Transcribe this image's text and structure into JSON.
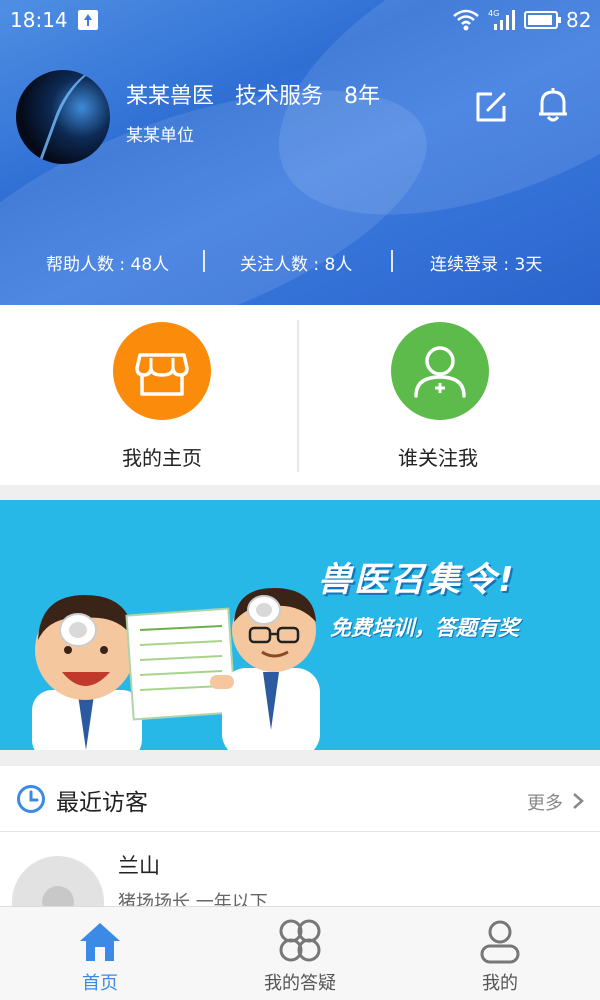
{
  "status_bar": {
    "time": "18:14",
    "battery": "82"
  },
  "profile": {
    "name": "某某兽医",
    "role": "技术服务",
    "years": "8年",
    "organization": "某某单位"
  },
  "stats": [
    {
      "label": "帮助人数 : 48人"
    },
    {
      "label": "关注人数 : 8人"
    },
    {
      "label": "连续登录 : 3天"
    }
  ],
  "actions": {
    "homepage_label": "我的主页",
    "followers_label": "谁关注我"
  },
  "banner": {
    "title": "兽医召集令!",
    "subtitle": "免费培训，答题有奖"
  },
  "recent_visitors": {
    "title": "最近访客",
    "more_label": "更多",
    "items": [
      {
        "name": "兰山",
        "description": "猪场场长  一年以下"
      }
    ]
  },
  "tabs": [
    {
      "label": "首页",
      "active": true
    },
    {
      "label": "我的答疑",
      "active": false
    },
    {
      "label": "我的",
      "active": false
    }
  ],
  "colors": {
    "header_blue": "#3b7be0",
    "orange": "#fb8c0b",
    "green": "#5cbb4a",
    "banner_blue": "#27b8e8",
    "tab_active": "#3b8be6"
  }
}
